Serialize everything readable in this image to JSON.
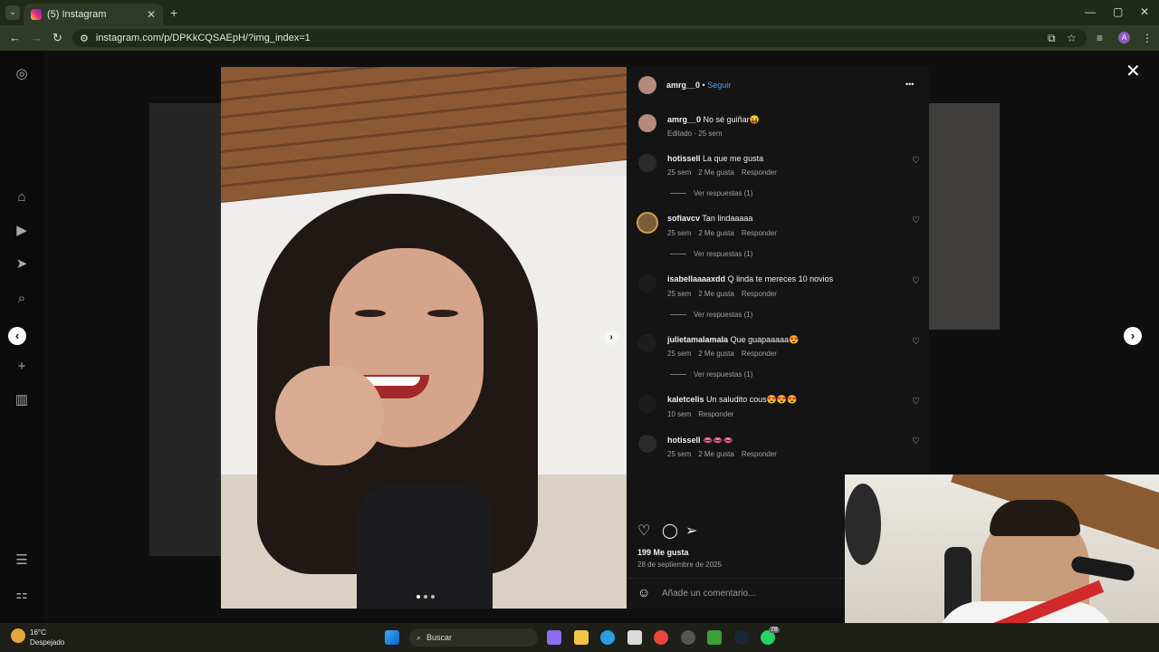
{
  "browser": {
    "tab_title": "(5) Instagram",
    "tab_close": "✕",
    "new_tab": "+",
    "url": "instagram.com/p/DPKkCQSAEpH/?img_index=1",
    "profile_initial": "A",
    "window_controls": [
      "—",
      "▢",
      "✕"
    ]
  },
  "post": {
    "author": "amrg__0",
    "separator": "•",
    "follow_label": "Seguir",
    "more": "•••",
    "caption_user": "amrg__0",
    "caption_text": "No sé guiñar😝",
    "caption_meta": "Editado · 25 sem",
    "close": "✕"
  },
  "comments": [
    {
      "user": "hotissell",
      "text": "La que me gusta",
      "time": "25 sem",
      "likes": "2 Me gusta",
      "reply": "Responder",
      "replies": "Ver respuestas (1)"
    },
    {
      "user": "sofiavcv",
      "text": "Tan lindaaaaa",
      "time": "25 sem",
      "likes": "2 Me gusta",
      "reply": "Responder",
      "replies": "Ver respuestas (1)"
    },
    {
      "user": "isabellaaaaxdd",
      "text": "Q linda te mereces 10 novios",
      "time": "25 sem",
      "likes": "2 Me gusta",
      "reply": "Responder",
      "replies": "Ver respuestas (1)"
    },
    {
      "user": "julietamalamala",
      "text": "Que guapaaaaa😍",
      "time": "25 sem",
      "likes": "2 Me gusta",
      "reply": "Responder",
      "replies": "Ver respuestas (1)"
    },
    {
      "user": "kaletcelis",
      "text": "Un saludito cous😍😍😍",
      "time": "10 sem",
      "likes": "",
      "reply": "Responder",
      "replies": ""
    },
    {
      "user": "hotissell",
      "text": "👄👄👄",
      "time": "25 sem",
      "likes": "2 Me gusta",
      "reply": "Responder",
      "replies": ""
    }
  ],
  "actions": {
    "likes_count": "199 Me gusta",
    "date": "28 de septiembre de 2025",
    "add_comment_placeholder": "Añade un comentario..."
  },
  "photo": {
    "carousel_count": 3,
    "carousel_active": 1
  },
  "taskbar": {
    "temperature": "16°C",
    "condition": "Despejado",
    "search_label": "Buscar",
    "steam_badge": "78"
  }
}
